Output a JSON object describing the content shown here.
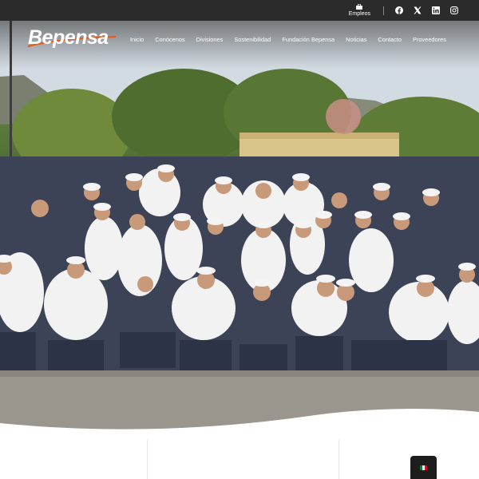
{
  "topbar": {
    "jobs_label": "Empleos",
    "social_icons": [
      "facebook-icon",
      "x-icon",
      "linkedin-icon",
      "instagram-icon"
    ]
  },
  "brand": {
    "logo_text": "Bepensa",
    "accent_color": "#e85d1a"
  },
  "nav": {
    "items": [
      "Inicio",
      "Conócenos",
      "Divisiones",
      "Sostenibilidad",
      "Fundación Bepensa",
      "Noticias",
      "Contacto",
      "Proveedores"
    ]
  },
  "language": {
    "flag": "mexico-flag-icon"
  }
}
